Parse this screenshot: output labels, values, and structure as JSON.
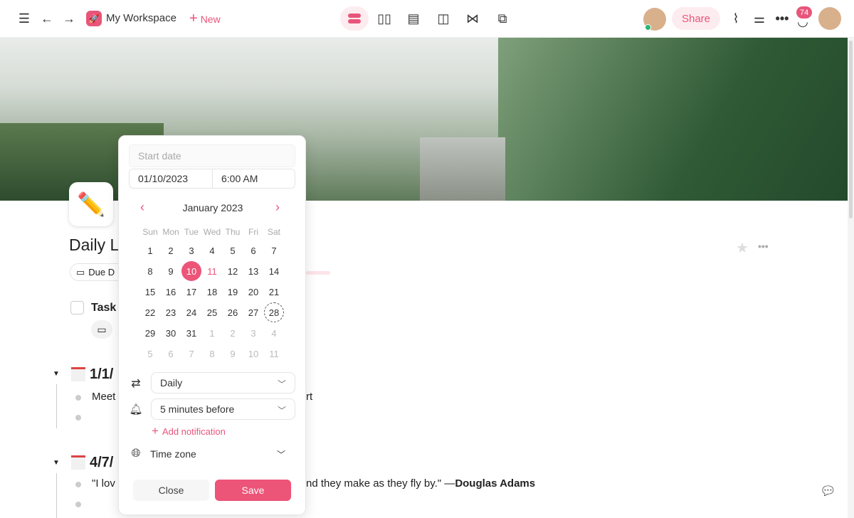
{
  "topbar": {
    "workspace": "My Workspace",
    "new_label": "New",
    "share_label": "Share",
    "notification_count": "74",
    "accent": "#e8557a"
  },
  "page": {
    "title": "Daily L",
    "due_label": "Due D",
    "task_label": "Task",
    "entries": [
      {
        "date": "1/1/",
        "bullet": "Meet",
        "bullet_tail": "rt"
      },
      {
        "date": "4/7/",
        "bullet": "\"I lov",
        "bullet_tail": "nd they make as they fly by.\" —",
        "author": "Douglas Adams"
      }
    ]
  },
  "picker": {
    "start_placeholder": "Start date",
    "date_value": "01/10/2023",
    "time_value": "6:00 AM",
    "month_label": "January 2023",
    "weekdays": [
      "Sun",
      "Mon",
      "Tue",
      "Wed",
      "Thu",
      "Fri",
      "Sat"
    ],
    "days": [
      [
        "1",
        "2",
        "3",
        "4",
        "5",
        "6",
        "7"
      ],
      [
        "8",
        "9",
        "10",
        "11",
        "12",
        "13",
        "14"
      ],
      [
        "15",
        "16",
        "17",
        "18",
        "19",
        "20",
        "21"
      ],
      [
        "22",
        "23",
        "24",
        "25",
        "26",
        "27",
        "28"
      ],
      [
        "29",
        "30",
        "31",
        "1",
        "2",
        "3",
        "4"
      ],
      [
        "5",
        "6",
        "7",
        "8",
        "9",
        "10",
        "11"
      ]
    ],
    "selected_day": "10",
    "today_day": "11",
    "hover_day": "28",
    "repeat_value": "Daily",
    "reminder_value": "5 minutes before",
    "add_notification": "Add notification",
    "timezone_label": "Time zone",
    "close_label": "Close",
    "save_label": "Save"
  }
}
